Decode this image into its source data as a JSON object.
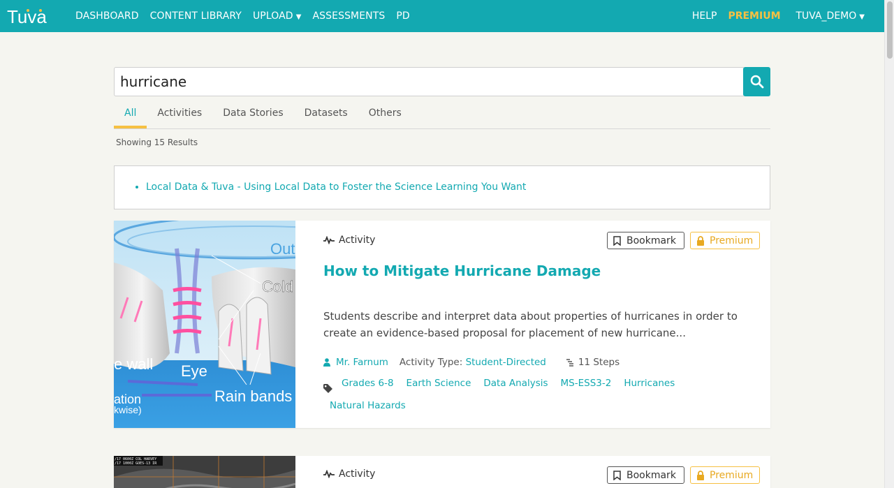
{
  "header": {
    "logo_text": "Tuva",
    "nav": [
      "DASHBOARD",
      "CONTENT LIBRARY",
      "UPLOAD",
      "ASSESSMENTS",
      "PD"
    ],
    "right": {
      "help": "HELP",
      "premium": "PREMIUM",
      "user": "TUVA_DEMO"
    }
  },
  "search": {
    "value": "hurricane"
  },
  "tabs": [
    "All",
    "Activities",
    "Data Stories",
    "Datasets",
    "Others"
  ],
  "showing": "Showing 15 Results",
  "notice": {
    "link": "Local Data & Tuva - Using Local Data to Foster the Science Learning You Want"
  },
  "cards": [
    {
      "type": "Activity",
      "bookmark_label": "Bookmark",
      "premium_label": "Premium",
      "title": "How to Mitigate Hurricane Damage",
      "description": "Students describe and interpret data about properties of hurricanes in order to create an evidence-based proposal for placement of new hurricane...",
      "author": "Mr. Farnum",
      "activity_type_label": "Activity Type:",
      "activity_type": "Student-Directed",
      "steps": "11 Steps",
      "tags": [
        "Grades 6-8",
        "Earth Science",
        "Data Analysis",
        "MS-ESS3-2",
        "Hurricanes",
        "Natural Hazards"
      ],
      "image_labels": {
        "outflow": "Out",
        "cold": "Cold",
        "eyewall": "e wall",
        "eye": "Eye",
        "rainbands": "Rain bands",
        "rotation": "ation",
        "direction": "kwise)"
      }
    },
    {
      "type": "Activity",
      "bookmark_label": "Bookmark",
      "premium_label": "Premium",
      "image_labels": {
        "line1": "/17 0600Z  COL HARVEY",
        "line2": "/17 1000Z  GOES-13 IR"
      }
    }
  ],
  "colors": {
    "brand": "#13a9b1",
    "accent": "#f6c042"
  }
}
